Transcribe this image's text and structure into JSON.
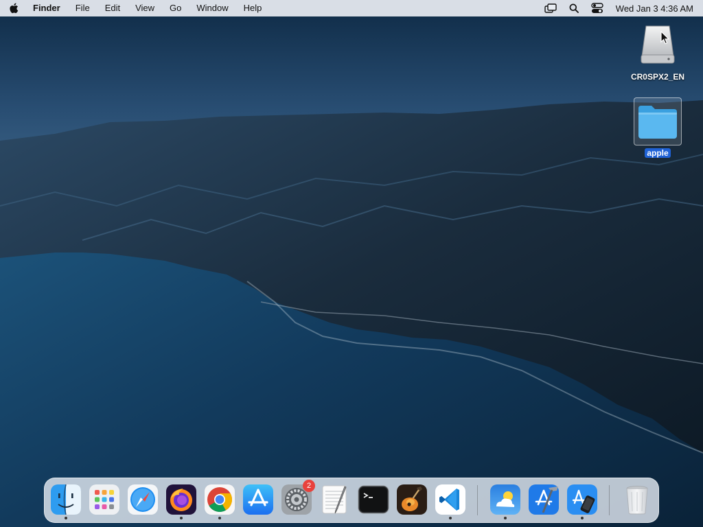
{
  "menubar": {
    "app_name": "Finder",
    "menus": [
      "File",
      "Edit",
      "View",
      "Go",
      "Window",
      "Help"
    ],
    "clock": "Wed Jan 3  4:36 AM",
    "status_icons": [
      "screen-mirroring-icon",
      "spotlight-search-icon",
      "control-center-icon"
    ]
  },
  "desktop": {
    "items": [
      {
        "label": "CR0SPX2_EN",
        "icon": "external-drive-icon",
        "selected": false
      },
      {
        "label": "apple",
        "icon": "folder-icon",
        "selected": true
      }
    ]
  },
  "dock": {
    "apps": [
      {
        "name": "Finder",
        "icon": "finder-icon",
        "running": true
      },
      {
        "name": "Launchpad",
        "icon": "launchpad-icon",
        "running": false
      },
      {
        "name": "Safari",
        "icon": "safari-icon",
        "running": false
      },
      {
        "name": "Firefox",
        "icon": "firefox-icon",
        "running": true
      },
      {
        "name": "Google Chrome",
        "icon": "chrome-icon",
        "running": true
      },
      {
        "name": "App Store",
        "icon": "app-store-icon",
        "running": false
      },
      {
        "name": "System Settings",
        "icon": "system-settings-icon",
        "running": false,
        "badge": "2"
      },
      {
        "name": "TextEdit",
        "icon": "textedit-icon",
        "running": false
      },
      {
        "name": "Terminal",
        "icon": "terminal-icon",
        "running": false
      },
      {
        "name": "GarageBand",
        "icon": "garageband-icon",
        "running": false
      },
      {
        "name": "Visual Studio Code",
        "icon": "vscode-icon",
        "running": true
      }
    ],
    "recent": [
      {
        "name": "Weather",
        "icon": "weather-icon",
        "running": true
      },
      {
        "name": "Xcode",
        "icon": "xcode-icon",
        "running": false
      },
      {
        "name": "Simulator",
        "icon": "simulator-icon",
        "running": true
      }
    ],
    "trash": {
      "name": "Trash",
      "icon": "trash-icon"
    }
  },
  "colors": {
    "accent_selection": "#1f62d6",
    "badge": "#e8413c",
    "menubar_bg": "#e8ecf2"
  }
}
